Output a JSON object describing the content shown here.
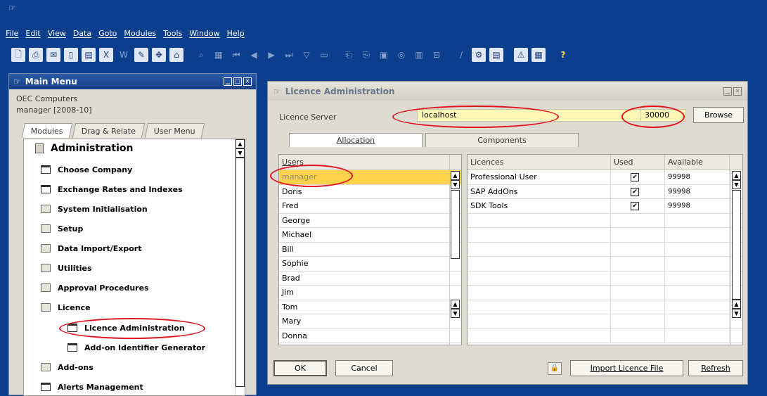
{
  "menu": [
    "File",
    "Edit",
    "View",
    "Data",
    "Goto",
    "Modules",
    "Tools",
    "Window",
    "Help"
  ],
  "toolbar_icons": [
    "preview-icon",
    "print-icon",
    "email-icon",
    "sms-icon",
    "export-excel-icon",
    "excel-icon",
    "word-icon",
    "launch-icon",
    "lock-screen-icon",
    "fax-icon",
    "find-icon",
    "add-icon",
    "first-record-icon",
    "previous-record-icon",
    "next-record-icon",
    "last-record-icon",
    "filter-icon",
    "sort-icon",
    "base-document-icon",
    "target-document-icon",
    "journal-icon",
    "payment-icon",
    "gross-profit-icon",
    "drill-icon",
    "form-settings-icon",
    "design-icon",
    "settings-icon",
    "alert-icon",
    "calendar-icon",
    "help-icon"
  ],
  "main_menu": {
    "title": "Main Menu",
    "company": "OEC Computers",
    "user": "manager  [2008-10]",
    "tabs": [
      "Modules",
      "Drag & Relate",
      "User Menu"
    ],
    "section": "Administration",
    "items": [
      {
        "label": "Choose Company",
        "icon": "form"
      },
      {
        "label": "Exchange Rates and Indexes",
        "icon": "form"
      },
      {
        "label": "System Initialisation",
        "icon": "folder"
      },
      {
        "label": "Setup",
        "icon": "folder"
      },
      {
        "label": "Data Import/Export",
        "icon": "folder"
      },
      {
        "label": "Utilities",
        "icon": "folder"
      },
      {
        "label": "Approval Procedures",
        "icon": "folder"
      },
      {
        "label": "Licence",
        "icon": "folder"
      },
      {
        "label": "Licence Administration",
        "icon": "form"
      },
      {
        "label": "Add-on Identifier Generator",
        "icon": "form"
      },
      {
        "label": "Add-ons",
        "icon": "folder"
      },
      {
        "label": "Alerts Management",
        "icon": "form"
      }
    ]
  },
  "licence_window": {
    "title": "Licence Administration",
    "server_label": "Licence Server",
    "server_value": "localhost",
    "port_value": "30000",
    "browse_label": "Browse",
    "tabs": [
      "Allocation",
      "Components"
    ],
    "users_header": "Users",
    "users": [
      "manager",
      "Doris",
      "Fred",
      "George",
      "Michael",
      "Bill",
      "Sophie",
      "Brad",
      "Jim",
      "Tom",
      "Mary",
      "Donna"
    ],
    "licence_headers": [
      "Licences",
      "Used",
      "Available"
    ],
    "licences": [
      {
        "name": "Professional User",
        "used": "✔",
        "available": "99998"
      },
      {
        "name": "SAP AddOns",
        "used": "✔",
        "available": "99998"
      },
      {
        "name": "SDK Tools",
        "used": "✔",
        "available": "99998"
      }
    ],
    "ok_label": "OK",
    "cancel_label": "Cancel",
    "import_label": "Import Licence File",
    "refresh_label": "Refresh"
  },
  "colors": {
    "accent": "#0b3f8e",
    "highlight": "#e3121f",
    "selected_row": "#ffd24c",
    "field_bg": "#fff7b8"
  }
}
